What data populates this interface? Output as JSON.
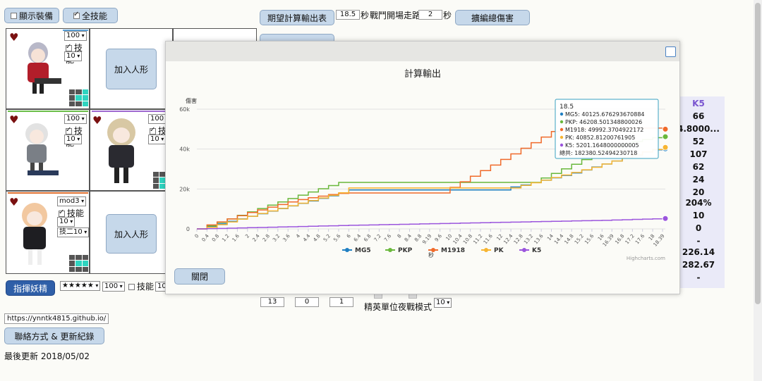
{
  "toolbar": {
    "show_equip_label": "顯示裝備",
    "all_skill_label": "全技能",
    "expected_output_label": "期望計算輸出表",
    "seconds_value": "18.5",
    "seconds_unit": "秒",
    "battle_walk_label": "戰鬥開場走路",
    "walk_value": "2",
    "walk_unit": "秒",
    "expand_damage_label": "擴編總傷害"
  },
  "formation": {
    "cells": [
      {
        "level": "100",
        "skill_label": "技能",
        "skill_level": "10",
        "frame_color": "#5aa0d8"
      },
      {
        "add_label": "加入人形"
      },
      {},
      {
        "level": "100",
        "skill_label": "技能",
        "skill_level": "10",
        "frame_color": "#6cbf4a"
      },
      {
        "level": "100",
        "skill_label": "技",
        "skill_level": "10",
        "frame_color": "#a06ad0"
      },
      {
        "level": "mod3",
        "skill_label": "技能",
        "skill_level": "10",
        "extra": "技二10",
        "frame_color": "#e07030"
      },
      {
        "add_label": "加入人形"
      }
    ]
  },
  "fairy": {
    "button_label": "指揮妖精",
    "stars": "★★★★★",
    "level": "100",
    "skill_label": "技能",
    "skill_level": "10"
  },
  "lower": {
    "v1": "13",
    "v2": "0",
    "v3": "1",
    "elite_label": "精英單位",
    "night_label": "夜戰模式",
    "night_value": "10"
  },
  "footer": {
    "url": "https://ynntk4815.github.io/",
    "contact_label": "聯絡方式 & 更新紀錄",
    "last_update": "最後更新 2018/05/02"
  },
  "stats_panel": {
    "header": "K5",
    "values": [
      "66",
      "4.8000...",
      "52",
      "107",
      "62",
      "24",
      "20",
      "204%",
      "10",
      "0",
      "-",
      "226.14",
      "282.67",
      "-"
    ]
  },
  "modal": {
    "close_label": "關閉",
    "credit": "Highcharts.com"
  },
  "tooltip": {
    "title": "18.5",
    "rows": [
      {
        "text": "MG5: 40125.676293670884",
        "color": "#1f7fc2"
      },
      {
        "text": "PKP: 46208.501348800026",
        "color": "#6ab83c"
      },
      {
        "text": "M1918: 49992.3704922172",
        "color": "#f06a2a"
      },
      {
        "text": "PK: 40852.81200761905",
        "color": "#f7b531"
      },
      {
        "text": "K5: 5201.1648000000005",
        "color": "#9b55dd"
      }
    ],
    "total": "總共: 182380.52494230718"
  },
  "colors": {
    "MG5": "#1f7fc2",
    "PKP": "#6ab83c",
    "M1918": "#f06a2a",
    "PK": "#f7b531",
    "K5": "#9b55dd"
  },
  "chart_data": {
    "type": "line",
    "title": "計算輸出",
    "xlabel": "秒",
    "ylabel": "傷害",
    "ylim": [
      0,
      60000
    ],
    "y_ticks": [
      "0",
      "20k",
      "40k",
      "60k"
    ],
    "x_ticks": [
      "0",
      "0.4",
      "0.8",
      "1.2",
      "1.6",
      "2",
      "2.4",
      "2.8",
      "3.2",
      "3.6",
      "4",
      "4.4",
      "4.8",
      "5.2",
      "5.6",
      "6",
      "6.4",
      "6.8",
      "7.2",
      "7.6",
      "8",
      "8.4",
      "8.8",
      "9.19",
      "9.6",
      "10",
      "10.4",
      "10.8",
      "11.2",
      "11.6",
      "12",
      "12.4",
      "12.8",
      "13.2",
      "13.6",
      "14",
      "14.4",
      "14.8",
      "15.2",
      "15.6",
      "16",
      "16.39",
      "16.8",
      "17.2",
      "17.6",
      "18",
      "18.39"
    ],
    "legend": [
      "MG5",
      "PKP",
      "M1918",
      "PK",
      "K5"
    ],
    "legend_position": "bottom",
    "grid": true,
    "series": [
      {
        "name": "MG5",
        "x": [
          0,
          0.4,
          0.8,
          1.2,
          1.6,
          2,
          2.4,
          2.8,
          3.2,
          3.6,
          4,
          4.4,
          4.8,
          5.2,
          5.6,
          6,
          12,
          12.4,
          12.8,
          13.2,
          13.6,
          14,
          14.4,
          14.8,
          15.2,
          15.6,
          16,
          16.39,
          16.8,
          17.2,
          17.6,
          18,
          18.5
        ],
        "values": [
          0,
          1000,
          2500,
          3800,
          5000,
          6300,
          7600,
          8900,
          10200,
          11500,
          12800,
          14000,
          15300,
          16600,
          17900,
          19500,
          19500,
          21000,
          22000,
          23200,
          24400,
          25600,
          26800,
          28000,
          29500,
          31000,
          32500,
          34000,
          35500,
          37000,
          38500,
          39600,
          40126
        ]
      },
      {
        "name": "PKP",
        "x": [
          0,
          0.4,
          0.8,
          1.2,
          1.6,
          2,
          2.4,
          2.8,
          3.2,
          3.6,
          4,
          4.4,
          4.8,
          5.2,
          5.6,
          6,
          13.2,
          13.6,
          14,
          14.4,
          14.8,
          15.2,
          15.6,
          16,
          16.39,
          16.8,
          17.2,
          17.6,
          18,
          18.5
        ],
        "values": [
          0,
          1500,
          3200,
          5000,
          6800,
          8500,
          10200,
          11900,
          13500,
          15200,
          16900,
          18500,
          20100,
          21700,
          23300,
          23300,
          23300,
          25500,
          27800,
          30100,
          32400,
          34700,
          37000,
          39300,
          41000,
          42500,
          43800,
          44800,
          45700,
          46209
        ]
      },
      {
        "name": "M1918",
        "x": [
          0,
          0.4,
          0.8,
          1.2,
          1.6,
          2,
          2.4,
          2.8,
          3.2,
          3.6,
          4,
          4.4,
          4.8,
          5.2,
          5.6,
          6,
          9.6,
          10,
          10.4,
          10.8,
          11.2,
          11.6,
          12,
          12.4,
          12.8,
          13.2,
          13.6,
          14,
          14.4,
          14.8,
          15.2,
          15.6,
          16,
          16.39,
          16.8,
          17.2,
          17.6,
          18,
          18.5
        ],
        "values": [
          0,
          2000,
          3500,
          5000,
          6600,
          8200,
          9500,
          10900,
          12200,
          13500,
          14700,
          15600,
          16400,
          17200,
          17800,
          18000,
          18000,
          20800,
          23600,
          26400,
          29200,
          32000,
          34800,
          37600,
          40400,
          43200,
          46000,
          48800,
          50500,
          50500,
          50500,
          50500,
          50500,
          50500,
          50500,
          50500,
          50500,
          50500,
          49992
        ]
      },
      {
        "name": "PK",
        "x": [
          0,
          0.4,
          0.8,
          1.2,
          1.6,
          2,
          2.4,
          2.8,
          3.2,
          3.6,
          4,
          4.4,
          4.8,
          5.2,
          5.6,
          6,
          12.4,
          12.8,
          13.2,
          13.6,
          14,
          14.4,
          14.8,
          15.2,
          15.6,
          16,
          16.39,
          16.8,
          17.2,
          17.6,
          18,
          18.5
        ],
        "values": [
          0,
          800,
          2100,
          3500,
          4900,
          6300,
          7700,
          9000,
          10300,
          11600,
          12900,
          14200,
          15500,
          16800,
          18100,
          20500,
          20500,
          21800,
          23100,
          24400,
          25700,
          27000,
          28300,
          29600,
          30900,
          32500,
          34000,
          35600,
          37100,
          38600,
          39800,
          40853
        ]
      },
      {
        "name": "K5",
        "x": [
          0,
          0.4,
          0.8,
          1.2,
          1.6,
          2,
          2.4,
          2.8,
          3.2,
          3.6,
          4,
          4.4,
          4.8,
          5.2,
          5.6,
          6,
          6.4,
          6.8,
          7.2,
          7.6,
          8,
          8.4,
          8.8,
          9.19,
          9.6,
          10,
          10.4,
          10.8,
          11.2,
          11.6,
          12,
          12.4,
          12.8,
          13.2,
          13.6,
          14,
          14.4,
          14.8,
          15.2,
          15.6,
          16,
          16.39,
          16.8,
          17.2,
          17.6,
          18,
          18.5
        ],
        "values": [
          0,
          120,
          240,
          360,
          480,
          600,
          720,
          840,
          960,
          1080,
          1200,
          1320,
          1440,
          1560,
          1680,
          1800,
          1900,
          2000,
          2100,
          2200,
          2300,
          2400,
          2500,
          2600,
          2700,
          2800,
          2900,
          3000,
          3100,
          3200,
          3300,
          3400,
          3500,
          3600,
          3700,
          3800,
          3900,
          4000,
          4100,
          4200,
          4300,
          4450,
          4600,
          4750,
          4900,
          5050,
          5201
        ]
      }
    ]
  }
}
